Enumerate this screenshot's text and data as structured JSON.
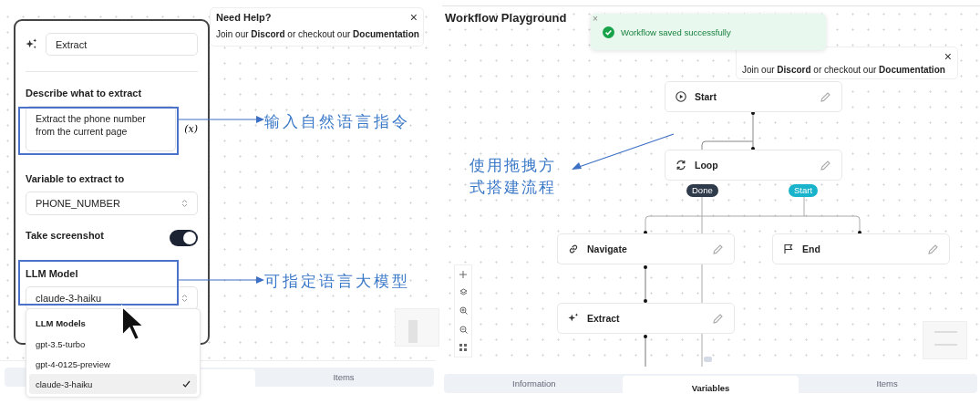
{
  "left_panel": {
    "help_popup": {
      "title": "Need Help?",
      "text": "Join our **Discord** or checkout our **Documentation**",
      "close": "×"
    },
    "step_editor": {
      "name_value": "Extract",
      "prompt_label": "Describe what to extract",
      "prompt_value": "Extract the phone number from the current page",
      "variable_button": "(x)",
      "variable_label": "Variable to extract to",
      "variable_value": "PHONE_NUMBER",
      "screenshot_label": "Take screenshot",
      "screenshot_on": true,
      "model_label": "LLM Model",
      "model_value": "claude-3-haiku"
    },
    "model_menu": {
      "header": "LLM Models",
      "options": [
        {
          "label": "gpt-3.5-turbo",
          "selected": false
        },
        {
          "label": "gpt-4-0125-preview",
          "selected": false
        },
        {
          "label": "claude-3-haiku",
          "selected": true
        }
      ]
    },
    "tabs": [
      {
        "selected": true
      },
      {
        "label": "Items",
        "selected": false
      }
    ]
  },
  "right_panel": {
    "title": "Workflow Playground",
    "toast": {
      "text": "Workflow saved successfully",
      "close": "×"
    },
    "help_popup": {
      "text": "Join our **Discord** or checkout our **Documentation**",
      "close": "×"
    },
    "nodes": [
      {
        "kind": "start",
        "label": "Start"
      },
      {
        "kind": "loop",
        "label": "Loop"
      },
      {
        "kind": "navigate",
        "label": "Navigate"
      },
      {
        "kind": "end",
        "label": "End"
      },
      {
        "kind": "extract",
        "label": "Extract"
      }
    ],
    "branch_badges": [
      {
        "kind": "done",
        "label": "Done"
      },
      {
        "kind": "start",
        "label": "Start"
      }
    ],
    "tabs": [
      {
        "label": "Information",
        "selected": false
      },
      {
        "label": "Variables",
        "selected": true
      },
      {
        "label": "Items",
        "selected": false
      }
    ]
  },
  "annotations": [
    {
      "text": "输入自然语言指令"
    },
    {
      "text": "可指定语言大模型"
    },
    {
      "text": "使用拖拽方式搭建流程"
    }
  ]
}
